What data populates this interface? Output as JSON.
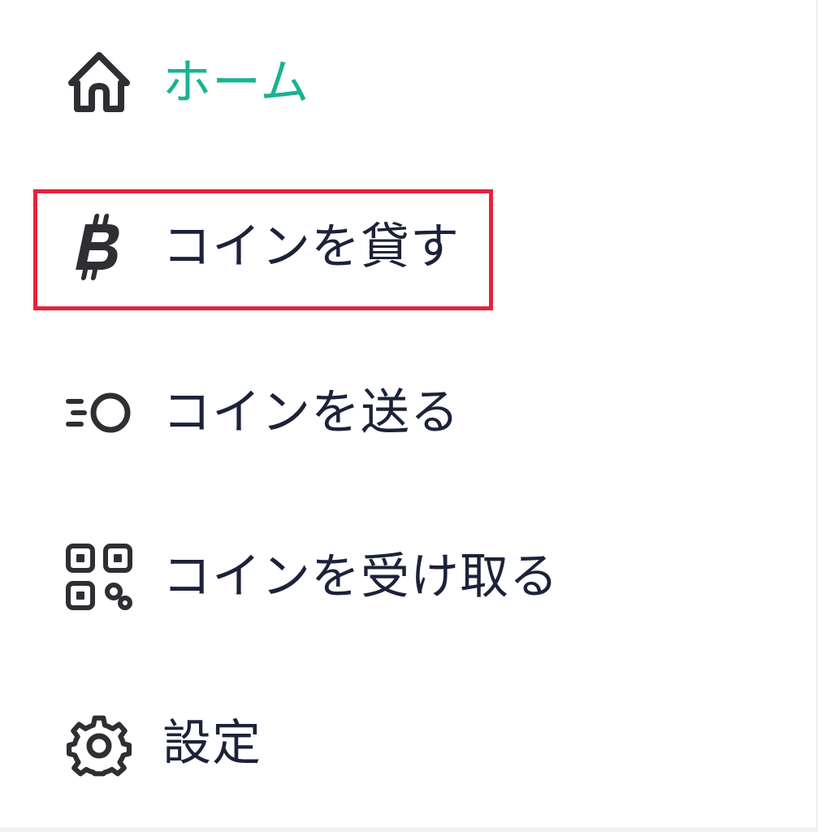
{
  "menu": {
    "items": [
      {
        "label": "ホーム",
        "icon": "home-icon",
        "active": true
      },
      {
        "label": "コインを貸す",
        "icon": "bitcoin-icon",
        "active": false
      },
      {
        "label": "コインを送る",
        "icon": "send-coin-icon",
        "active": false
      },
      {
        "label": "コインを受け取る",
        "icon": "qr-code-icon",
        "active": false
      },
      {
        "label": "設定",
        "icon": "gear-icon",
        "active": false
      }
    ]
  },
  "colors": {
    "active_text": "#19b394",
    "text": "#1c2238",
    "icon": "#2d2f33",
    "highlight_border": "#e8223c"
  }
}
